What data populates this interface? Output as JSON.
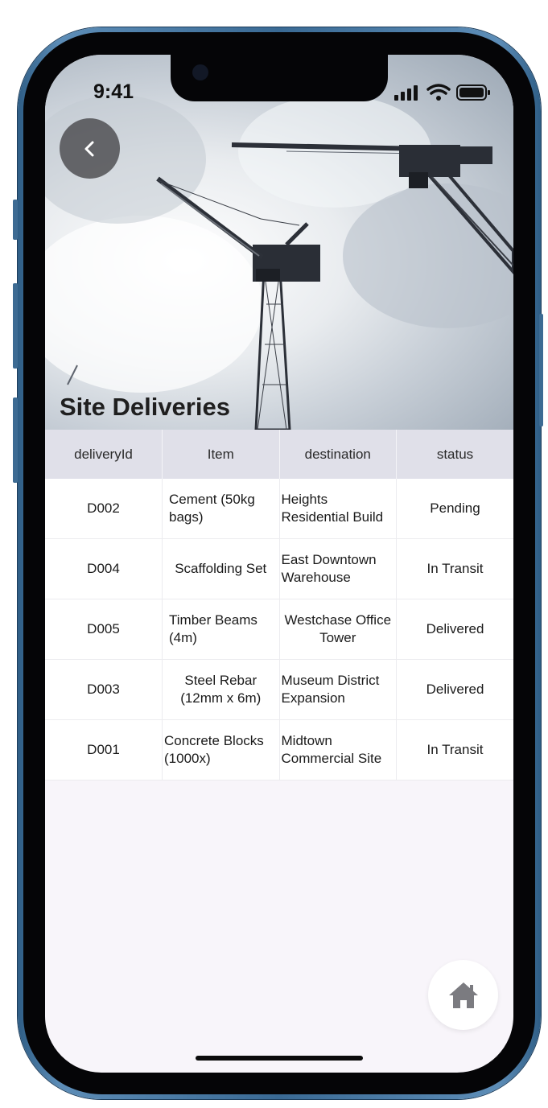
{
  "status_bar": {
    "time": "9:41"
  },
  "header": {
    "title": "Site Deliveries",
    "back_icon": "chevron-left-icon"
  },
  "table": {
    "columns": [
      "deliveryId",
      "Item",
      "destination",
      "status"
    ],
    "rows": [
      {
        "deliveryId": "D002",
        "item": "Cement (50kg bags)",
        "destination": "Heights Residential Build",
        "status": "Pending"
      },
      {
        "deliveryId": "D004",
        "item": "Scaffolding Set",
        "destination": "East Downtown Warehouse",
        "status": "In Transit"
      },
      {
        "deliveryId": "D005",
        "item": "Timber Beams (4m)",
        "destination": "Westchase Office Tower",
        "status": "Delivered"
      },
      {
        "deliveryId": "D003",
        "item": "Steel Rebar (12mm x 6m)",
        "destination": "Museum District Expansion",
        "status": "Delivered"
      },
      {
        "deliveryId": "D001",
        "item": "Concrete Blocks (1000x)",
        "destination": "Midtown Commercial Site",
        "status": "In Transit"
      }
    ]
  },
  "fab": {
    "icon": "home-icon"
  },
  "colors": {
    "header_bg": "#e0e0e9",
    "screen_bg": "#f8f5fa",
    "frame": "#3a6a94"
  }
}
